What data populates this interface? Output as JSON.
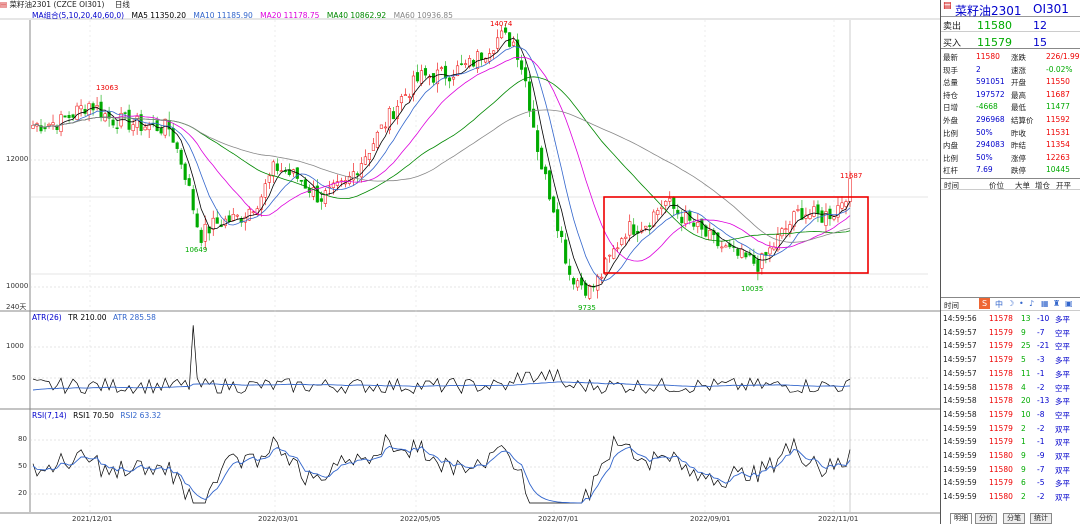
{
  "header": {
    "title": "菜籽油2301",
    "title_code": "(CZCE OI301)",
    "period": "日线"
  },
  "ma_legend": {
    "group": "MA组合(5,10,20,40,60,0)",
    "ma5": "MA5 11350.20",
    "ma10": "MA10 11185.90",
    "ma20": "MA20 11178.75",
    "ma40": "MA40 10862.92",
    "ma60": "MA60 10936.85"
  },
  "atr_legend": {
    "name": "ATR(26)",
    "tr": "TR 210.00",
    "atr": "ATR 285.58"
  },
  "rsi_legend": {
    "name": "RSI(7,14)",
    "rsi1": "RSI1 70.50",
    "rsi2": "RSI2 63.32"
  },
  "chart_data": {
    "type": "candlestick",
    "y_ticks": [
      "12000",
      "10000"
    ],
    "atr_ticks": [
      "1000",
      "500"
    ],
    "rsi_ticks": [
      "80",
      "50",
      "20"
    ],
    "x_ticks": [
      "2021/12/01",
      "2022/03/01",
      "2022/05/05",
      "2022/07/01",
      "2022/09/01",
      "2022/11/01"
    ],
    "annotations": {
      "high1": "13063",
      "low1": "10649",
      "peak": "14074",
      "low2": "9735",
      "low3": "10035",
      "last_high": "11687"
    },
    "bottom_label": "240天",
    "range_box": {
      "from_date": "2022/07/01",
      "to_date": "2022/11/01",
      "low": 10100,
      "high": 11400
    }
  },
  "quote": {
    "name": "菜籽油2301",
    "code": "OI301",
    "sell_label": "卖出",
    "sell_price": "11580",
    "sell_vol": "12",
    "buy_label": "买入",
    "buy_price": "11579",
    "buy_vol": "15",
    "stats": [
      [
        "最新",
        "11580",
        "涨跌",
        "226/1.99%"
      ],
      [
        "现手",
        "2",
        "速涨",
        "-0.02%"
      ],
      [
        "总量",
        "591051",
        "开盘",
        "11550"
      ],
      [
        "持仓",
        "197572",
        "最高",
        "11687"
      ],
      [
        "日增",
        "-4668",
        "最低",
        "11477"
      ],
      [
        "外盘",
        "296968",
        "结算价",
        "11592"
      ],
      [
        "比例",
        "50%",
        "昨收",
        "11531"
      ],
      [
        "内盘",
        "294083",
        "昨结",
        "11354"
      ],
      [
        "比例",
        "50%",
        "涨停",
        "12263"
      ],
      [
        "杠杆",
        "7.69",
        "跌停",
        "10445"
      ]
    ],
    "tick_header": [
      "时间",
      "价位",
      "大单",
      "增仓",
      "开平"
    ],
    "time_label": "时间"
  },
  "ticks": [
    [
      "14:59:56",
      "11578",
      "13",
      "-10",
      "多平"
    ],
    [
      "14:59:57",
      "11579",
      "9",
      "-7",
      "空平"
    ],
    [
      "14:59:57",
      "11579",
      "25",
      "-21",
      "空平"
    ],
    [
      "14:59:57",
      "11579",
      "5",
      "-3",
      "多平"
    ],
    [
      "14:59:57",
      "11578",
      "11",
      "-1",
      "多平"
    ],
    [
      "14:59:58",
      "11578",
      "4",
      "-2",
      "空平"
    ],
    [
      "14:59:58",
      "11578",
      "20",
      "-13",
      "多平"
    ],
    [
      "14:59:58",
      "11579",
      "10",
      "-8",
      "空平"
    ],
    [
      "14:59:59",
      "11579",
      "2",
      "-2",
      "双平"
    ],
    [
      "14:59:59",
      "11579",
      "1",
      "-1",
      "双平"
    ],
    [
      "14:59:59",
      "11580",
      "9",
      "-9",
      "双平"
    ],
    [
      "14:59:59",
      "11580",
      "9",
      "-7",
      "双平"
    ],
    [
      "14:59:59",
      "11579",
      "6",
      "-5",
      "多平"
    ],
    [
      "14:59:59",
      "11580",
      "2",
      "-2",
      "双平"
    ]
  ],
  "tabs": [
    "明细",
    "分价",
    "分笔",
    "统计"
  ]
}
